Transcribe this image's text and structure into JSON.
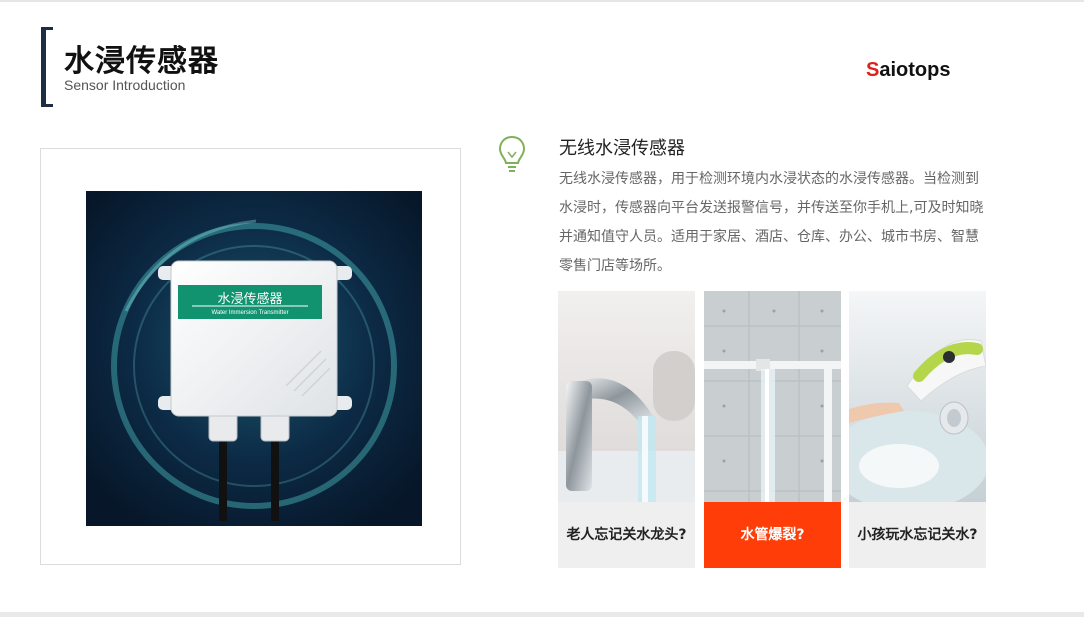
{
  "header": {
    "title": "水浸传感器",
    "subtitle": "Sensor Introduction"
  },
  "brand": {
    "first_letter": "S",
    "rest": "aiotops",
    "accent_color": "#e0201c"
  },
  "product": {
    "label_cn": "水浸传感器",
    "label_en": "Water Immersion Transmitter"
  },
  "intro": {
    "icon": "lightbulb-icon",
    "title": "无线水浸传感器",
    "description": "无线水浸传感器，用于检测环境内水浸状态的水浸传感器。当检测到水浸时，传感器向平台发送报警信号，并传送至你手机上,可及时知晓并通知值守人员。适用于家居、酒店、仓库、办公、城市书房、智慧零售门店等场所。"
  },
  "scenarios": [
    {
      "caption": "老人忘记关水龙头?"
    },
    {
      "caption": "水管爆裂?",
      "highlight_color": "#ff3d08"
    },
    {
      "caption": "小孩玩水忘记关水?"
    }
  ]
}
